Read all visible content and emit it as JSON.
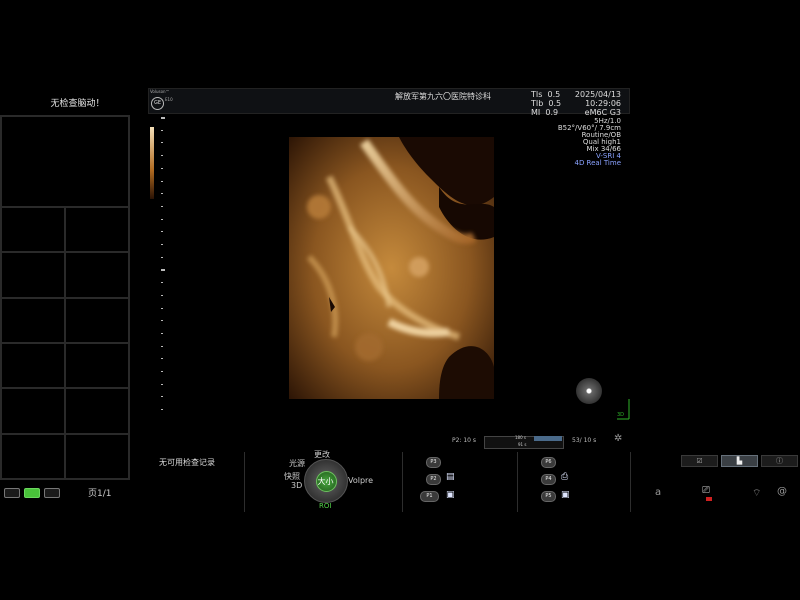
{
  "left_panel": {
    "title": "无检查脑动！",
    "page_label": "页1/1",
    "layout_buttons": [
      "layout-1x2",
      "layout-2x2",
      "layout-3x3"
    ],
    "active_layout": "layout-2x2"
  },
  "header": {
    "logo_top": "Voluson™",
    "logo_brand": "GE",
    "logo_model": "E10",
    "hospital": "解放军第九六〇医院特诊科",
    "indices": [
      {
        "label": "TIs",
        "value": "0.5"
      },
      {
        "label": "TIb",
        "value": "0.5"
      },
      {
        "label": "MI",
        "value": "0.9"
      }
    ],
    "date": "2025/04/13",
    "time": "10:29:06",
    "probe": "eM6C G3"
  },
  "params": {
    "freq": "5Hz/1.0",
    "angles": "B52°/V60°/ 7.9cm",
    "preset": "Routine/OB",
    "quality": "Qual high1",
    "mix": "Mix 34/66",
    "render": "V-SRI 4",
    "mode": "4D Real Time"
  },
  "progress": {
    "p2_label": "P2:  10 s",
    "bar_text1": "180 s",
    "bar_text2": "91 s",
    "fill_fraction": 0.36,
    "s3_label": "53/ 10 s"
  },
  "axis": {
    "label": "3D"
  },
  "bottom": {
    "no_records": "无可用检查记录",
    "knob_center": "大小",
    "knob_top": "更改",
    "knob_upper_left": "光源",
    "knob_left1": "快照",
    "knob_left2": "3D",
    "knob_right": "Volpre",
    "knob_bottom": "ROI",
    "p_buttons": [
      {
        "label": "P3"
      },
      {
        "label": "P2"
      },
      {
        "label": "P1"
      },
      {
        "label": "P6"
      },
      {
        "label": "P4"
      },
      {
        "label": "P5"
      }
    ],
    "right_tabs": [
      "checklist-icon",
      "chart-icon",
      "info-icon"
    ],
    "status_letter": "a"
  },
  "colors": {
    "accent_green": "#49c23a",
    "render_gold": "#c58a3c",
    "param_blue": "#8aa2ff"
  }
}
